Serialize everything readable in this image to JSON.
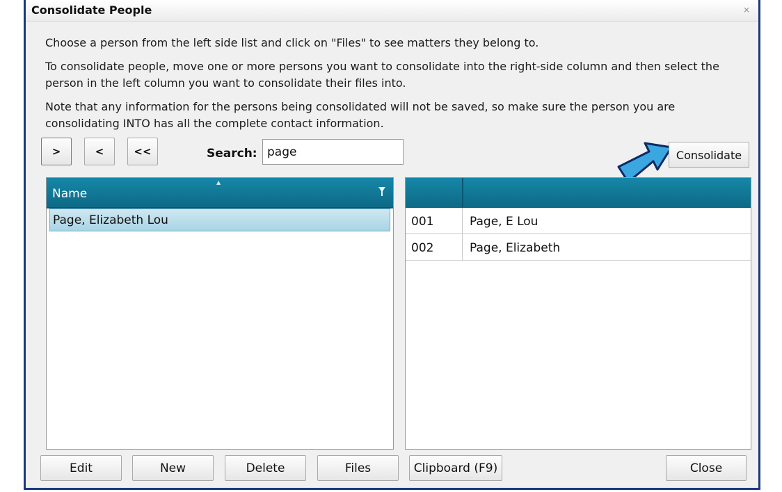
{
  "window": {
    "title": "Consolidate People",
    "close_glyph": "⨯"
  },
  "instructions": {
    "line1": "Choose a person from the left side list and click on \"Files\" to see matters they belong to.",
    "line2": "To consolidate people, move one or more persons you want to consolidate into the right-side column and then select the person in the left column you want to consolidate their files into.",
    "line3": "Note that any information for the persons being consolidated will not be saved, so make sure the person you are consolidating INTO has all the complete contact information."
  },
  "toolbar": {
    "move_right": ">",
    "move_left": "<",
    "move_all_left": "<<",
    "search_label": "Search:",
    "search_value": "page",
    "consolidate": "Consolidate"
  },
  "left_grid": {
    "header": "Name",
    "rows": [
      "Page, Elizabeth Lou"
    ]
  },
  "right_grid": {
    "rows": [
      {
        "id": "001",
        "name": "Page, E Lou"
      },
      {
        "id": "002",
        "name": "Page, Elizabeth"
      }
    ]
  },
  "buttons": {
    "edit": "Edit",
    "new": "New",
    "delete": "Delete",
    "files": "Files",
    "clipboard": "Clipboard (F9)",
    "close": "Close"
  },
  "colors": {
    "header_teal": "#1687a8",
    "selected_row": "#a9d4e5",
    "annotation_arrow": "#3aa7e0",
    "window_border": "#1a3a7a"
  }
}
